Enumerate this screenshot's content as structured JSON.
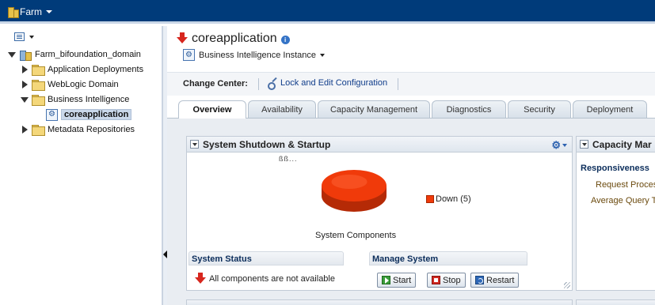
{
  "topbar": {
    "farm_label": "Farm"
  },
  "tree": {
    "root": "Farm_bifoundation_domain",
    "items": [
      {
        "label": "Application Deployments"
      },
      {
        "label": "WebLogic Domain"
      },
      {
        "label": "Business Intelligence"
      },
      {
        "label": "coreapplication"
      },
      {
        "label": "Metadata Repositories"
      }
    ]
  },
  "page": {
    "title": "coreapplication",
    "target_menu": "Business Intelligence Instance"
  },
  "change_center": {
    "label": "Change Center:",
    "lock_link": "Lock and Edit Configuration"
  },
  "tabs": [
    {
      "label": "Overview",
      "active": true
    },
    {
      "label": "Availability"
    },
    {
      "label": "Capacity Management"
    },
    {
      "label": "Diagnostics"
    },
    {
      "label": "Security"
    },
    {
      "label": "Deployment"
    }
  ],
  "shutdown_region": {
    "title": "System Shutdown & Startup",
    "loading": "ßß...",
    "legend_label": "Down (5)",
    "pie_caption": "System Components",
    "system_status": {
      "title": "System Status",
      "message": "All components are not available"
    },
    "manage_system": {
      "title": "Manage System",
      "start": "Start",
      "stop": "Stop",
      "restart": "Restart"
    }
  },
  "capacity_region": {
    "title": "Capacity Mar",
    "responsiveness": "Responsiveness",
    "request_processing": "Request Proces",
    "average_query": "Average Query T"
  },
  "chart_data": {
    "type": "pie",
    "categories": [
      "Down"
    ],
    "values": [
      5
    ],
    "colors": [
      "#f03a0a"
    ],
    "legend": [
      "Down (5)"
    ]
  }
}
